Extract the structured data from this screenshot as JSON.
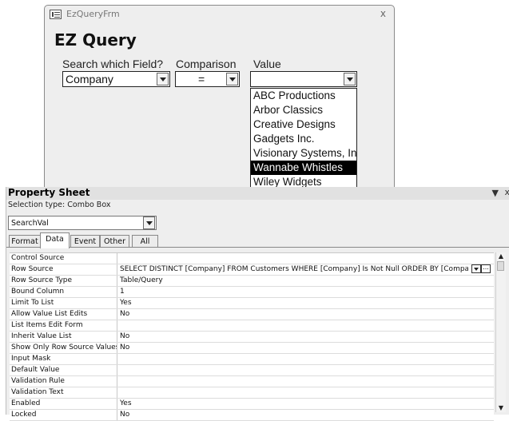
{
  "form": {
    "window_title": "EzQueryFrm",
    "close_glyph": "x",
    "heading": "EZ Query",
    "labels": {
      "field": "Search which Field?",
      "comparison": "Comparison",
      "value": "Value"
    },
    "field_combo": {
      "value": "Company"
    },
    "comparison_combo": {
      "value": "="
    },
    "value_combo": {
      "value": ""
    },
    "value_options": [
      "ABC Productions",
      "Arbor Classics",
      "Creative Designs",
      "Gadgets Inc.",
      "Visionary Systems, Inc",
      "Wannabe Whistles",
      "Wiley Widgets"
    ],
    "selected_option": "Wannabe Whistles"
  },
  "property_sheet": {
    "title": "Property Sheet",
    "pin_glyph": "▼",
    "close_glyph": "x",
    "selection_type": "Selection type:  Combo Box",
    "object_combo": "SearchVal",
    "tabs": {
      "format": "Format",
      "data": "Data",
      "event": "Event",
      "other": "Other",
      "all": "All"
    },
    "active_tab": "Data",
    "rows": [
      {
        "name": "Control Source",
        "value": ""
      },
      {
        "name": "Row Source",
        "value": "SELECT DISTINCT [Company] FROM Customers WHERE [Company] Is Not Null ORDER BY [Company];"
      },
      {
        "name": "Row Source Type",
        "value": "Table/Query"
      },
      {
        "name": "Bound Column",
        "value": "1"
      },
      {
        "name": "Limit To List",
        "value": "Yes"
      },
      {
        "name": "Allow Value List Edits",
        "value": "No"
      },
      {
        "name": "List Items Edit Form",
        "value": ""
      },
      {
        "name": "Inherit Value List",
        "value": "No"
      },
      {
        "name": "Show Only Row Source Values",
        "value": "No"
      },
      {
        "name": "Input Mask",
        "value": ""
      },
      {
        "name": "Default Value",
        "value": ""
      },
      {
        "name": "Validation Rule",
        "value": ""
      },
      {
        "name": "Validation Text",
        "value": ""
      },
      {
        "name": "Enabled",
        "value": "Yes"
      },
      {
        "name": "Locked",
        "value": "No"
      }
    ],
    "build_button_glyph": "...",
    "scroll_up_glyph": "▲",
    "scroll_down_glyph": "▼"
  }
}
